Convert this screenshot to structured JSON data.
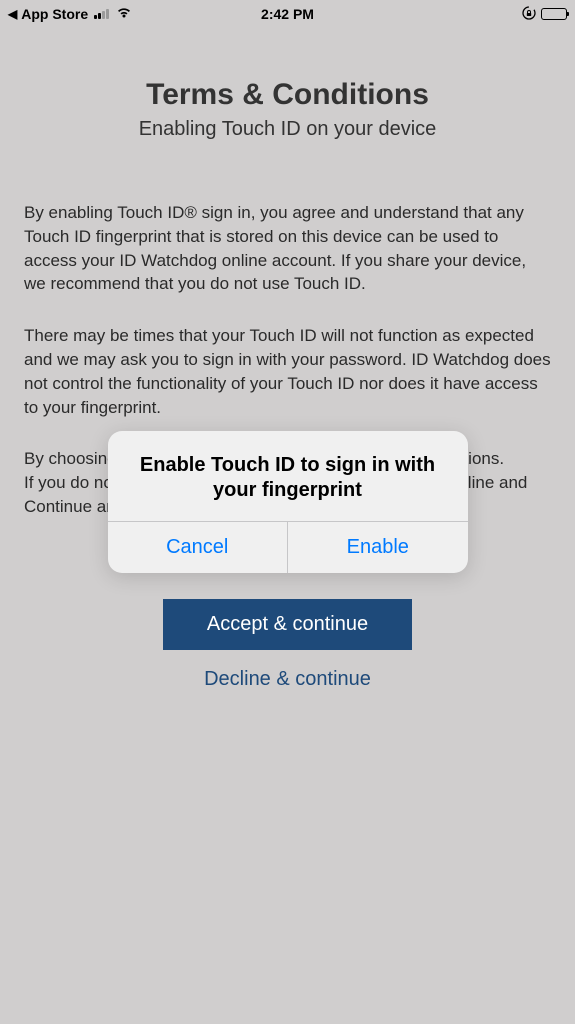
{
  "statusBar": {
    "backLabel": "App Store",
    "time": "2:42 PM"
  },
  "page": {
    "title": "Terms & Conditions",
    "subtitle": "Enabling Touch ID on your device",
    "para1": "By enabling Touch ID® sign in, you agree and understand that any Touch ID fingerprint that is stored on this device can be used to access your ID Watchdog online account.  If you share your device, we recommend that you do not use Touch ID.",
    "para2": "There may be times that your Touch ID will not function as expected and we may ask you to sign in with your password. ID Watchdog does not control the functionality of your Touch ID nor does it have access to your fingerprint.",
    "para3": "By choosing to Accept & Continue, you accept these conditions.\nIf you do not want to use Touch ID for sign in, you may Decline and Continue and sign in without enabling Touch ID.",
    "acceptLabel": "Accept & continue",
    "declineLabel": "Decline & continue"
  },
  "dialog": {
    "title": "Enable Touch ID to sign in with your fingerprint",
    "cancelLabel": "Cancel",
    "enableLabel": "Enable"
  }
}
